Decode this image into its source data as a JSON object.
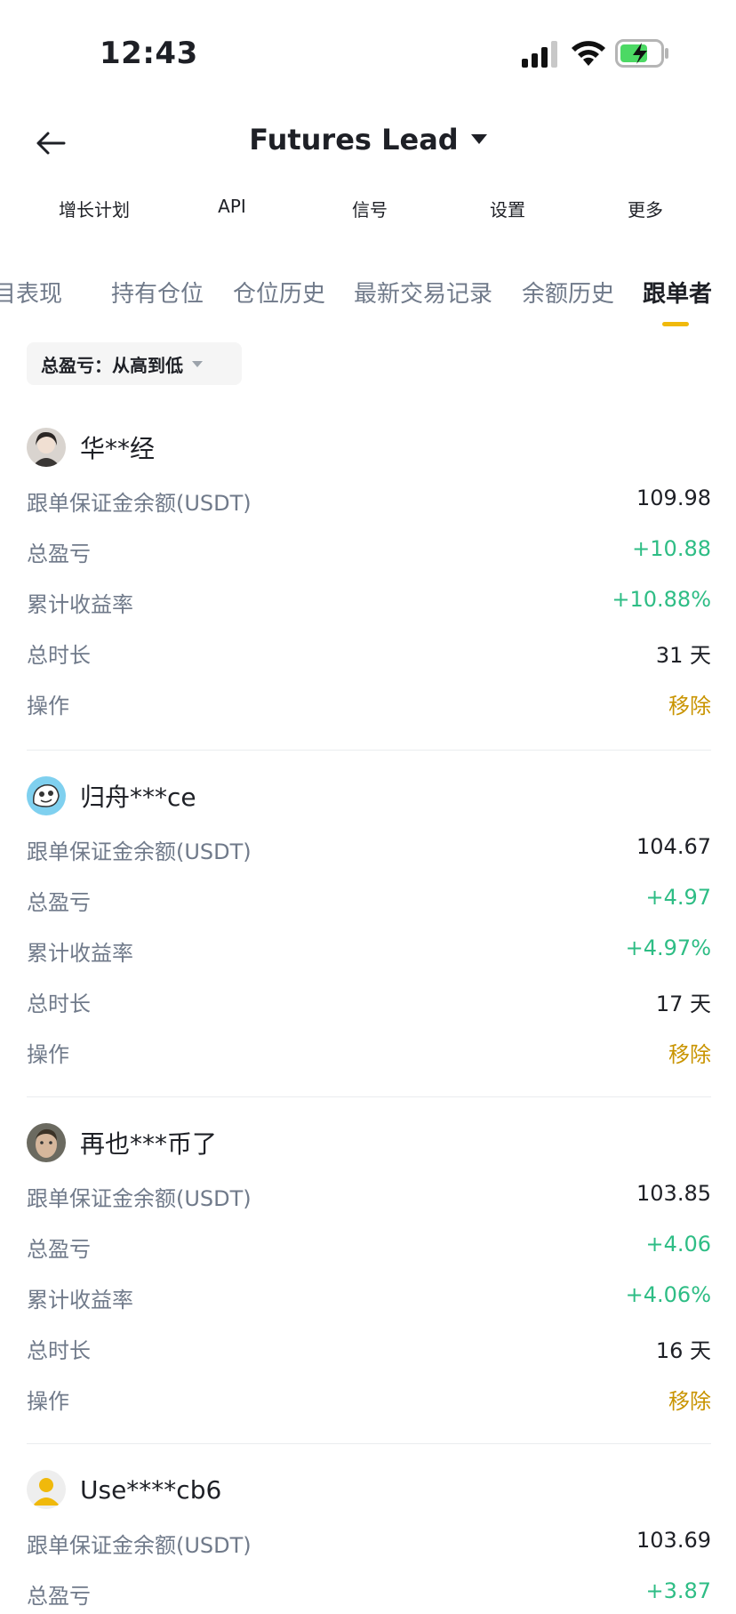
{
  "status": {
    "time": "12:43"
  },
  "header": {
    "title": "Futures Lead"
  },
  "menu": [
    {
      "label": "增长计划"
    },
    {
      "label": "API"
    },
    {
      "label": "信号"
    },
    {
      "label": "设置"
    },
    {
      "label": "更多"
    }
  ],
  "tabs": [
    {
      "label": "目表现"
    },
    {
      "label": "持有仓位"
    },
    {
      "label": "仓位历史"
    },
    {
      "label": "最新交易记录"
    },
    {
      "label": "余额历史"
    },
    {
      "label": "跟单者",
      "active": true
    }
  ],
  "sort": {
    "label": "总盈亏：从高到低"
  },
  "colors": {
    "accent": "#f0b90b",
    "profit": "#2ebd85",
    "action": "#c99400",
    "muted": "#707a8a"
  },
  "followers": [
    {
      "name": "华**经",
      "avatar": "avatar-photo-portrait",
      "rows": [
        {
          "k": "跟单保证金余额(USDT)",
          "v": "109.98"
        },
        {
          "k": "总盈亏",
          "v": "+10.88"
        },
        {
          "k": "累计收益率",
          "v": "+10.88%"
        },
        {
          "k": "总时长",
          "v": "31 天"
        },
        {
          "k": "操作",
          "v": "移除"
        }
      ]
    },
    {
      "name": "归舟***ce",
      "avatar": "avatar-cartoon-blue",
      "rows": [
        {
          "k": "跟单保证金余额(USDT)",
          "v": "104.67"
        },
        {
          "k": "总盈亏",
          "v": "+4.97"
        },
        {
          "k": "累计收益率",
          "v": "+4.97%"
        },
        {
          "k": "总时长",
          "v": "17 天"
        },
        {
          "k": "操作",
          "v": "移除"
        }
      ]
    },
    {
      "name": "再也***币了",
      "avatar": "avatar-photo-face",
      "rows": [
        {
          "k": "跟单保证金余额(USDT)",
          "v": "103.85"
        },
        {
          "k": "总盈亏",
          "v": "+4.06"
        },
        {
          "k": "累计收益率",
          "v": "+4.06%"
        },
        {
          "k": "总时长",
          "v": "16 天"
        },
        {
          "k": "操作",
          "v": "移除"
        }
      ]
    },
    {
      "name": "Use****cb6",
      "avatar": "avatar-default-yellow",
      "rows": [
        {
          "k": "跟单保证金余额(USDT)",
          "v": "103.69"
        },
        {
          "k": "总盈亏",
          "v": "+3.87"
        }
      ]
    }
  ]
}
